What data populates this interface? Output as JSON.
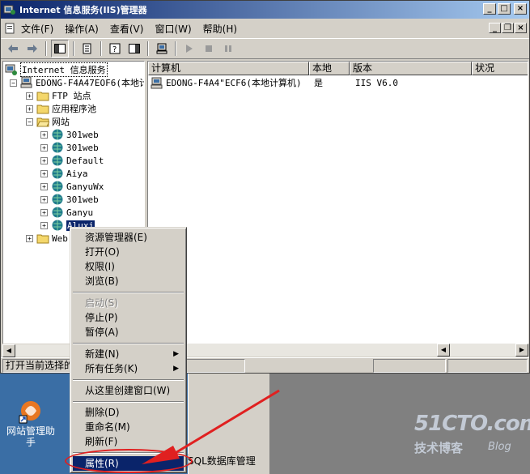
{
  "window": {
    "title": "Internet 信息服务(IIS)管理器",
    "min": "_",
    "max": "□",
    "close": "×"
  },
  "menu": {
    "items": [
      "文件(F)",
      "操作(A)",
      "查看(V)",
      "窗口(W)",
      "帮助(H)"
    ]
  },
  "tree": {
    "root": "Internet 信息服务",
    "server": "EDONG-F4A47EOF6(本地计",
    "ftp": "FTP 站点",
    "apppool": "应用程序池",
    "websites": "网站",
    "sites": [
      "301web",
      "301web",
      "Default",
      "Aiya",
      "GanyuWx",
      "301web",
      "Ganyu",
      "Aluxi"
    ],
    "webext": "Web"
  },
  "list": {
    "columns": [
      "计算机",
      "本地",
      "版本",
      "状况"
    ],
    "rows": [
      {
        "computer": "EDONG-F4A4\"ECF6(本地计算机)",
        "local": "是",
        "version": "IIS V6.0",
        "status": ""
      }
    ]
  },
  "status": {
    "text": "打开当前选择的"
  },
  "context_menu": {
    "items": [
      {
        "label": "资源管理器(E)",
        "disabled": false
      },
      {
        "label": "打开(O)",
        "disabled": false
      },
      {
        "label": "权限(I)",
        "disabled": false
      },
      {
        "label": "浏览(B)",
        "disabled": false
      },
      {
        "label": "启动(S)",
        "disabled": true
      },
      {
        "label": "停止(P)",
        "disabled": false
      },
      {
        "label": "暂停(A)",
        "disabled": false
      },
      {
        "label": "新建(N)",
        "disabled": false,
        "submenu": true
      },
      {
        "label": "所有任务(K)",
        "disabled": false,
        "submenu": true
      },
      {
        "label": "从这里创建窗口(W)",
        "disabled": false
      },
      {
        "label": "删除(D)",
        "disabled": false
      },
      {
        "label": "重命名(M)",
        "disabled": false
      },
      {
        "label": "刷新(F)",
        "disabled": false
      },
      {
        "label": "属性(R)",
        "disabled": false,
        "highlighted": true
      }
    ]
  },
  "desktop": {
    "icon_label": "网站管理助手",
    "task_text": "SQL数据库管理"
  },
  "watermark": {
    "site": "51CTO.com",
    "blog_cn": "技术博客",
    "blog_en": "Blog"
  },
  "colors": {
    "title_start": "#0a246a",
    "title_end": "#a6caf0",
    "highlight": "#0a246a",
    "annotation": "#e02020",
    "desktop": "#3a6ea5"
  }
}
